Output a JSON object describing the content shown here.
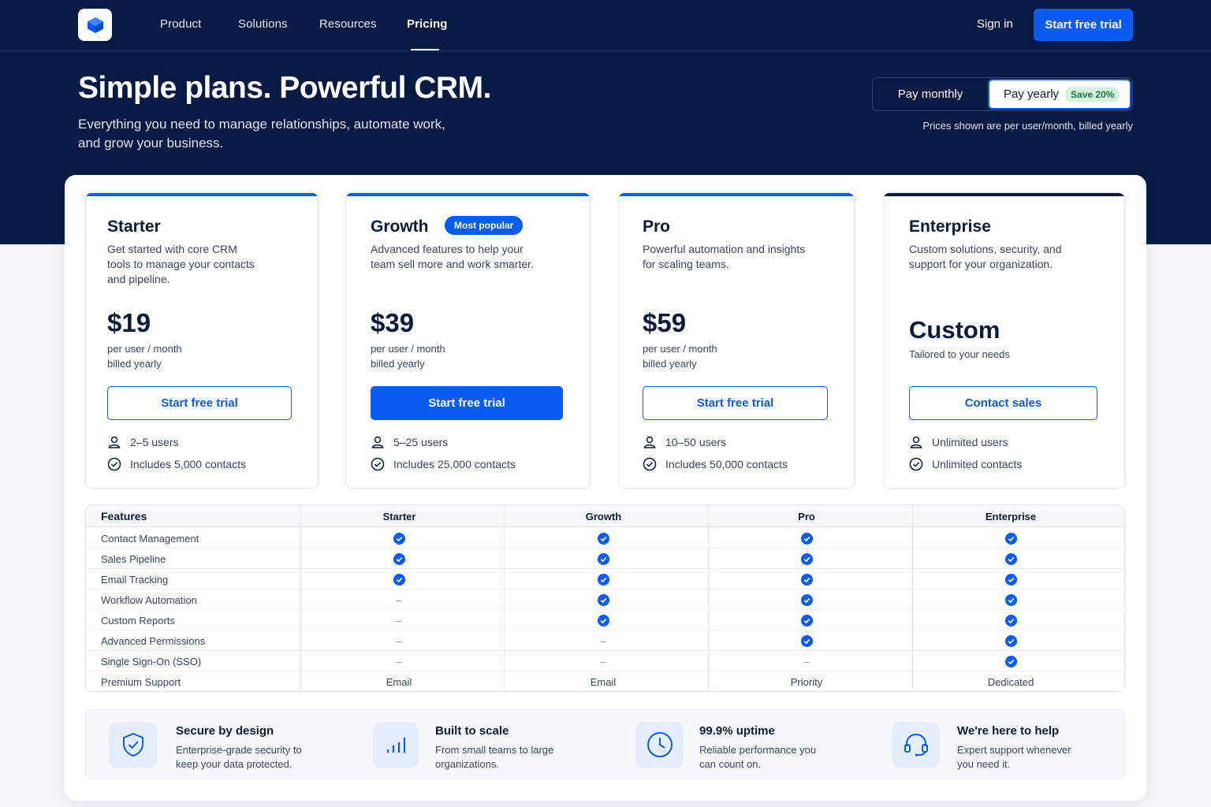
{
  "nav": {
    "links": [
      "Product",
      "Solutions",
      "Resources",
      "Pricing"
    ],
    "active": "Pricing",
    "sign_in": "Sign in",
    "cta": "Start free trial"
  },
  "hero": {
    "title": "Simple plans. Powerful CRM.",
    "subtitle_line1": "Everything you need to manage relationships, automate work,",
    "subtitle_line2": "and grow your business."
  },
  "billing": {
    "monthly": "Pay monthly",
    "yearly": "Pay yearly",
    "save_badge": "Save 20%",
    "selected": "yearly",
    "note": "Prices shown are per user/month, billed yearly"
  },
  "plans": [
    {
      "name": "Starter",
      "desc_lines": [
        "Get started with core CRM",
        "tools to manage your contacts",
        "and pipeline."
      ],
      "price": "$19",
      "unit_line1": "per user / month",
      "unit_line2": "billed yearly",
      "button": "Start free trial",
      "users": "2–5 users",
      "contacts": "Includes 5,000 contacts"
    },
    {
      "name": "Growth",
      "badge": "Most popular",
      "desc_lines": [
        "Advanced features to help your",
        "team sell more and work smarter."
      ],
      "price": "$39",
      "unit_line1": "per user / month",
      "unit_line2": "billed yearly",
      "button": "Start free trial",
      "users": "5–25 users",
      "contacts": "Includes 25,000 contacts"
    },
    {
      "name": "Pro",
      "desc_lines": [
        "Powerful automation and insights",
        "for scaling teams."
      ],
      "price": "$59",
      "unit_line1": "per user / month",
      "unit_line2": "billed yearly",
      "button": "Start free trial",
      "users": "10–50 users",
      "contacts": "Includes 50,000 contacts"
    },
    {
      "name": "Enterprise",
      "desc_lines": [
        "Custom solutions, security, and",
        "support for your organization."
      ],
      "price": "Custom",
      "unit_line1": "Tailored to your needs",
      "button": "Contact sales",
      "users": "Unlimited users",
      "contacts": "Unlimited contacts"
    }
  ],
  "features_table": {
    "header": [
      "Features",
      "Starter",
      "Growth",
      "Pro",
      "Enterprise"
    ],
    "rows": [
      {
        "name": "Contact Management",
        "cells": [
          "check",
          "check",
          "check",
          "check"
        ]
      },
      {
        "name": "Sales Pipeline",
        "cells": [
          "check",
          "check",
          "check",
          "check"
        ]
      },
      {
        "name": "Email Tracking",
        "cells": [
          "check",
          "check",
          "check",
          "check"
        ]
      },
      {
        "name": "Workflow Automation",
        "cells": [
          "–",
          "check",
          "check",
          "check"
        ]
      },
      {
        "name": "Custom Reports",
        "cells": [
          "–",
          "check",
          "check",
          "check"
        ]
      },
      {
        "name": "Advanced Permissions",
        "cells": [
          "–",
          "–",
          "check",
          "check"
        ]
      },
      {
        "name": "Single Sign-On (SSO)",
        "cells": [
          "–",
          "–",
          "–",
          "check"
        ]
      },
      {
        "name": "Premium Support",
        "cells": [
          "Email",
          "Email",
          "Priority",
          "Dedicated"
        ]
      }
    ]
  },
  "highlights": [
    {
      "icon": "shield-icon",
      "title": "Secure by design",
      "desc_lines": [
        "Enterprise-grade security to",
        "keep your data protected."
      ]
    },
    {
      "icon": "bar-chart-icon",
      "title": "Built to scale",
      "desc_lines": [
        "From small teams to large",
        "organizations."
      ]
    },
    {
      "icon": "clock-icon",
      "title": "99.9% uptime",
      "desc_lines": [
        "Reliable performance you",
        "can count on."
      ]
    },
    {
      "icon": "headset-icon",
      "title": "We're here to help",
      "desc_lines": [
        "Expert support whenever",
        "you need it."
      ]
    }
  ],
  "colors": {
    "navy": "#061a44",
    "accent": "#0a5cf0",
    "badge_green_bg": "#d6f3e2",
    "badge_green_text": "#187a45"
  }
}
